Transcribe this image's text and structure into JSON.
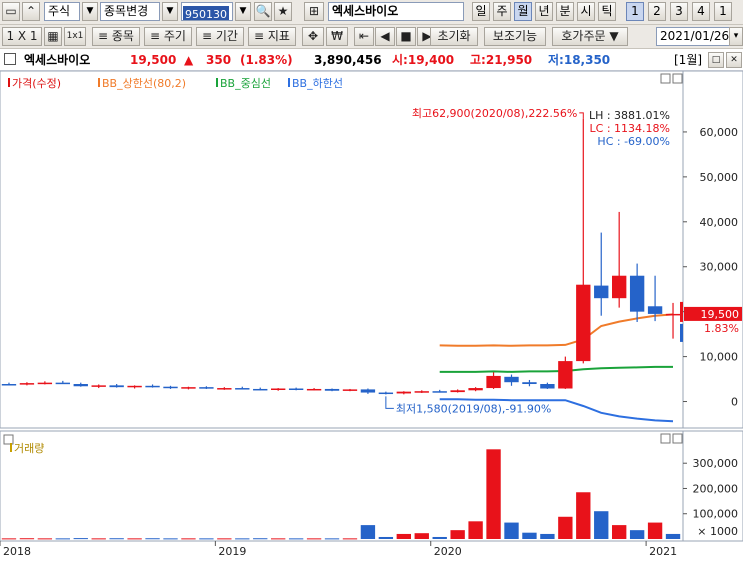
{
  "toolbar": {
    "market": "주식",
    "change_item": "종목변경",
    "code": "950130",
    "stock_name": "엑세스바이오",
    "periods": [
      "일",
      "주",
      "월",
      "년",
      "분",
      "시",
      "틱"
    ],
    "active_period": "월",
    "numbers": [
      "1",
      "2",
      "3",
      "4",
      "1"
    ],
    "layout": "1 X 1",
    "item_btn": "≡ 종목",
    "cycle_btn": "≡ 주기",
    "span_btn": "≡ 기간",
    "indicator_btn": "≡ 지표",
    "reset_btn": "초기화",
    "aux_btn": "보조기능",
    "order_btn": "호가주문",
    "date": "2021/01/26"
  },
  "info": {
    "name": "엑세스바이오",
    "price": "19,500",
    "change_arrow": "▲",
    "change": "350",
    "change_pct": "(1.83%)",
    "volume": "3,890,456",
    "open_label": "시:19,400",
    "high_label": "고:21,950",
    "low_label": "저:18,350",
    "period_unit": "[1월]"
  },
  "colors": {
    "up": "#e8121a",
    "down": "#2563c9",
    "bb_upper": "#f07b2a",
    "bb_mid": "#1aa33a",
    "bb_lower": "#2d6fe0"
  },
  "chart_data": [
    {
      "type": "candlestick",
      "title": "",
      "legend": [
        "가격(수정)",
        "BB_상한선(80,2)",
        "BB_중심선",
        "BB_하한선"
      ],
      "ylim": [
        -5000,
        70000
      ],
      "y_ticks": [
        "60,000",
        "50,000",
        "40,000",
        "30,000",
        "20,000",
        "10,000",
        "0"
      ],
      "x_ticks": [
        "2018",
        "2019",
        "2020",
        "2021"
      ],
      "start_month": "2018-01",
      "candles": [
        [
          3900,
          4200,
          3700,
          3800
        ],
        [
          3800,
          4300,
          3600,
          4100
        ],
        [
          4100,
          4500,
          3800,
          4200
        ],
        [
          4200,
          4600,
          3900,
          3900
        ],
        [
          3900,
          4200,
          3300,
          3400
        ],
        [
          3400,
          3800,
          3000,
          3600
        ],
        [
          3600,
          3900,
          3100,
          3200
        ],
        [
          3200,
          3600,
          2900,
          3500
        ],
        [
          3500,
          3800,
          3100,
          3300
        ],
        [
          3300,
          3500,
          2800,
          3000
        ],
        [
          3000,
          3300,
          2700,
          3200
        ],
        [
          3200,
          3400,
          2800,
          2900
        ],
        [
          2900,
          3200,
          2600,
          3000
        ],
        [
          3000,
          3300,
          2700,
          2800
        ],
        [
          2800,
          3100,
          2500,
          2700
        ],
        [
          2700,
          3000,
          2400,
          2900
        ],
        [
          2900,
          3100,
          2500,
          2600
        ],
        [
          2600,
          3000,
          2500,
          2800
        ],
        [
          2800,
          2900,
          2300,
          2400
        ],
        [
          2400,
          2800,
          2300,
          2700
        ],
        [
          2700,
          2900,
          1700,
          2000
        ],
        [
          2000,
          2200,
          1580,
          1800
        ],
        [
          1800,
          2300,
          1600,
          2200
        ],
        [
          2200,
          2500,
          1900,
          2300
        ],
        [
          2300,
          2600,
          2000,
          2100
        ],
        [
          2100,
          2700,
          2000,
          2500
        ],
        [
          2500,
          3200,
          2300,
          3000
        ],
        [
          3000,
          6500,
          2800,
          5700
        ],
        [
          5500,
          6000,
          3500,
          4300
        ],
        [
          4300,
          4800,
          3400,
          3900
        ],
        [
          3900,
          4200,
          2800,
          2900
        ],
        [
          2900,
          10000,
          2800,
          9000
        ],
        [
          9000,
          62900,
          8500,
          26000
        ],
        [
          25800,
          37600,
          19100,
          23000
        ],
        [
          23000,
          42200,
          20900,
          28000
        ],
        [
          28000,
          30700,
          17700,
          20000
        ],
        [
          21200,
          28000,
          17900,
          19500
        ],
        [
          19400,
          21950,
          14000,
          19500
        ]
      ],
      "bb_upper": {
        "start_index": 24,
        "values": [
          12500,
          12400,
          12400,
          12500,
          12400,
          12500,
          12500,
          12600,
          13800,
          16800,
          17800,
          18500,
          19100,
          19400
        ]
      },
      "bb_mid": {
        "start_index": 24,
        "values": [
          6600,
          6600,
          6600,
          6700,
          6600,
          6700,
          6700,
          6800,
          7200,
          7400,
          7500,
          7600,
          7700,
          7700
        ]
      },
      "bb_lower": {
        "start_index": 24,
        "values": [
          500,
          500,
          400,
          400,
          300,
          300,
          300,
          300,
          -1000,
          -2500,
          -3300,
          -3800,
          -4200,
          -4400
        ]
      },
      "annotations": {
        "high": "최고62,900(2020/08),222.56%",
        "low": "최저1,580(2019/08),-91.90%"
      },
      "stats": {
        "LH": "LH : 3881.01%",
        "LC": "LC : 1134.18%",
        "HC": "HC :  -69.00%"
      },
      "last_price_tag": "19,500",
      "last_pct_tag": "1.83%"
    },
    {
      "type": "bar",
      "title": "",
      "legend": [
        "거래량"
      ],
      "unit": "× 1000",
      "ylim": [
        0,
        380000
      ],
      "y_ticks": [
        "300,000",
        "200,000",
        "100,000"
      ],
      "volumes": [
        2500,
        3000,
        2500,
        2500,
        3500,
        2500,
        3000,
        2500,
        3000,
        2500,
        2500,
        2500,
        2500,
        2500,
        3000,
        2500,
        2500,
        2500,
        2500,
        2500,
        55000,
        8000,
        20000,
        23000,
        8000,
        35000,
        70000,
        355000,
        65000,
        25000,
        20000,
        88000,
        185000,
        110000,
        55000,
        35000,
        65000,
        20000
      ],
      "up": [
        1,
        1,
        1,
        0,
        0,
        1,
        0,
        1,
        0,
        0,
        1,
        0,
        1,
        0,
        0,
        1,
        0,
        1,
        0,
        1,
        0,
        0,
        1,
        1,
        0,
        1,
        1,
        1,
        0,
        0,
        0,
        1,
        1,
        0,
        1,
        0,
        1,
        0
      ]
    }
  ]
}
